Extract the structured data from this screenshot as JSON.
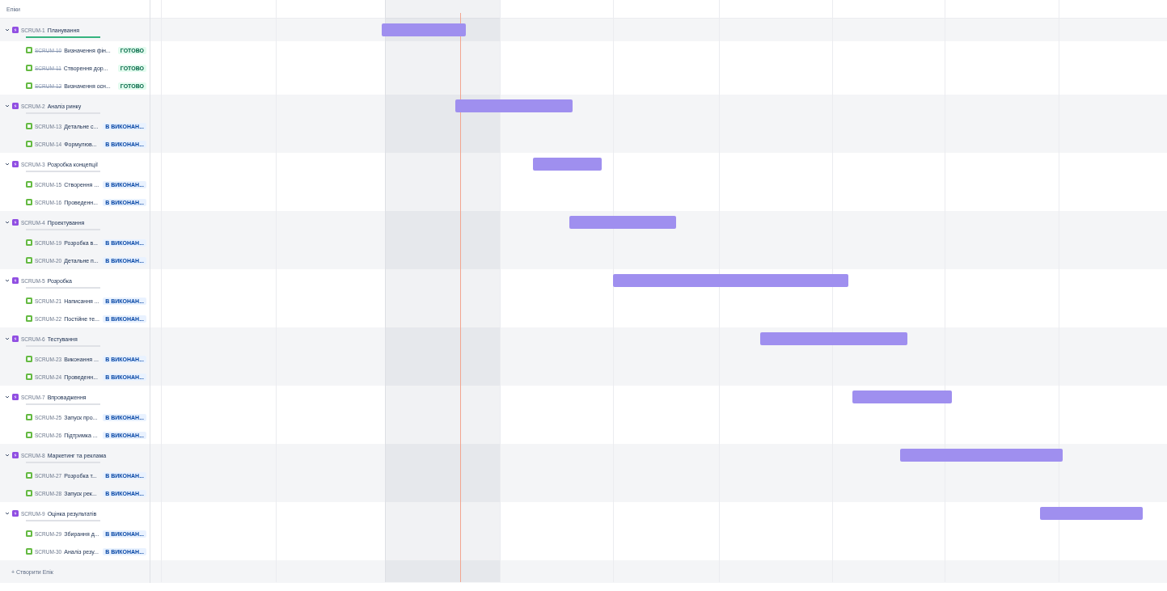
{
  "header": "Епіки",
  "epics": [
    {
      "key": "SCRUM-1",
      "title": "Планування",
      "expanded": true,
      "done": true,
      "children": [
        {
          "key": "SCRUM-10",
          "title": "Визначення фін...",
          "done": true,
          "status": "ГОТОВО"
        },
        {
          "key": "SCRUM-11",
          "title": "Створення дор...",
          "done": true,
          "status": "ГОТОВО"
        },
        {
          "key": "SCRUM-12",
          "title": "Визначення осн...",
          "done": true,
          "status": "ГОТОВО"
        }
      ]
    },
    {
      "key": "SCRUM-2",
      "title": "Аналіз ринку",
      "expanded": true,
      "done": false,
      "children": [
        {
          "key": "SCRUM-13",
          "title": "Детальне с...",
          "done": false,
          "status": "В ВИКОНАН..."
        },
        {
          "key": "SCRUM-14",
          "title": "Формулюв...",
          "done": false,
          "status": "В ВИКОНАН..."
        }
      ]
    },
    {
      "key": "SCRUM-3",
      "title": "Розробка концепції",
      "expanded": true,
      "done": false,
      "children": [
        {
          "key": "SCRUM-15",
          "title": "Створення ...",
          "done": false,
          "status": "В ВИКОНАН..."
        },
        {
          "key": "SCRUM-16",
          "title": "Проведенн...",
          "done": false,
          "status": "В ВИКОНАН..."
        }
      ]
    },
    {
      "key": "SCRUM-4",
      "title": "Проектування",
      "expanded": true,
      "done": false,
      "children": [
        {
          "key": "SCRUM-19",
          "title": "Розробка в...",
          "done": false,
          "status": "В ВИКОНАН..."
        },
        {
          "key": "SCRUM-20",
          "title": "Детальне п...",
          "done": false,
          "status": "В ВИКОНАН..."
        }
      ]
    },
    {
      "key": "SCRUM-5",
      "title": "Розробка",
      "expanded": true,
      "done": false,
      "children": [
        {
          "key": "SCRUM-21",
          "title": "Написання ...",
          "done": false,
          "status": "В ВИКОНАН..."
        },
        {
          "key": "SCRUM-22",
          "title": "Постійне те...",
          "done": false,
          "status": "В ВИКОНАН..."
        }
      ]
    },
    {
      "key": "SCRUM-6",
      "title": "Тестування",
      "expanded": true,
      "done": false,
      "children": [
        {
          "key": "SCRUM-23",
          "title": "Виконання ...",
          "done": false,
          "status": "В ВИКОНАН..."
        },
        {
          "key": "SCRUM-24",
          "title": "Проведенн...",
          "done": false,
          "status": "В ВИКОНАН..."
        }
      ]
    },
    {
      "key": "SCRUM-7",
      "title": "Впровадження",
      "expanded": true,
      "done": false,
      "children": [
        {
          "key": "SCRUM-25",
          "title": "Запуск про...",
          "done": false,
          "status": "В ВИКОНАН..."
        },
        {
          "key": "SCRUM-26",
          "title": "Підтримка ...",
          "done": false,
          "status": "В ВИКОНАН..."
        }
      ]
    },
    {
      "key": "SCRUM-8",
      "title": "Маркетинг та реклама",
      "expanded": true,
      "done": false,
      "children": [
        {
          "key": "SCRUM-27",
          "title": "Розробка т...",
          "done": false,
          "status": "В ВИКОНАН..."
        },
        {
          "key": "SCRUM-28",
          "title": "Запуск рек...",
          "done": false,
          "status": "В ВИКОНАН..."
        }
      ]
    },
    {
      "key": "SCRUM-9",
      "title": "Оцінка результатів",
      "expanded": true,
      "done": false,
      "children": [
        {
          "key": "SCRUM-29",
          "title": "Збирання д...",
          "done": false,
          "status": "В ВИКОНАН..."
        },
        {
          "key": "SCRUM-30",
          "title": "Аналіз резу...",
          "done": false,
          "status": "В ВИКОНАН..."
        }
      ]
    }
  ],
  "create": "+ Створити Епік"
}
